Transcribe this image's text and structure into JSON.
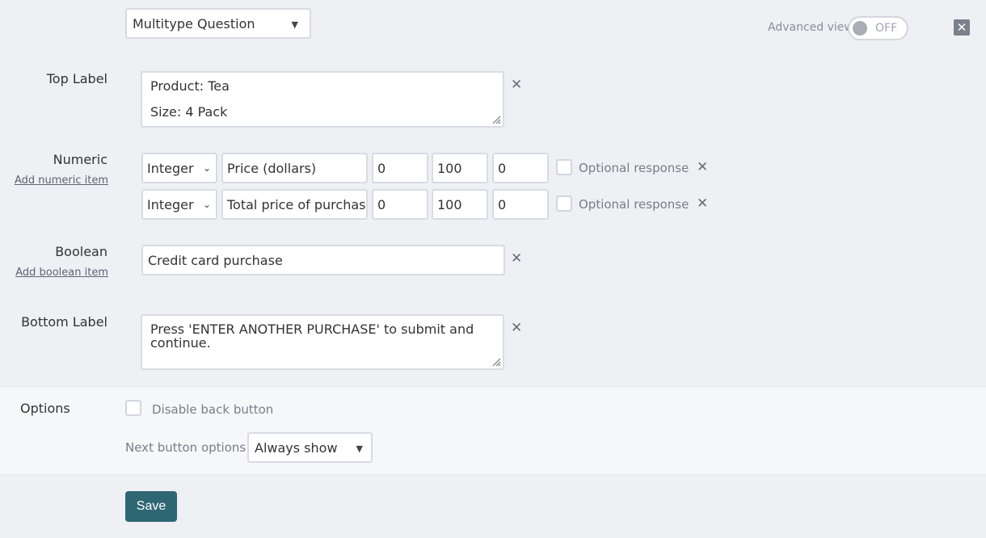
{
  "question_type": {
    "selected": "Multitype Question"
  },
  "advanced_view": {
    "label": "Advanced view",
    "state": "OFF"
  },
  "top_label": {
    "label": "Top Label",
    "lines": [
      "Product: Tea",
      "Size: 4 Pack"
    ]
  },
  "numeric": {
    "label": "Numeric",
    "add_link": "Add numeric item",
    "items": [
      {
        "type": "Integer",
        "text": "Price (dollars)",
        "min": "0",
        "max": "100",
        "default": "0",
        "optional_label": "Optional response"
      },
      {
        "type": "Integer",
        "text": "Total price of purchase",
        "min": "0",
        "max": "100",
        "default": "0",
        "optional_label": "Optional response"
      }
    ]
  },
  "boolean": {
    "label": "Boolean",
    "add_link": "Add boolean item",
    "value": "Credit card purchase"
  },
  "bottom_label": {
    "label": "Bottom Label",
    "lines": [
      "Press 'ENTER ANOTHER PURCHASE' to submit and",
      "continue."
    ]
  },
  "options": {
    "label": "Options",
    "disable_back_label": "Disable back button",
    "next_button_label": "Next button options:",
    "next_button_selected": "Always show"
  },
  "save_label": "Save",
  "icons": {
    "remove": "close-x-icon",
    "close": "close-box-icon",
    "select_arrow": "triangle-down-icon",
    "chevron": "chevron-down-icon"
  }
}
